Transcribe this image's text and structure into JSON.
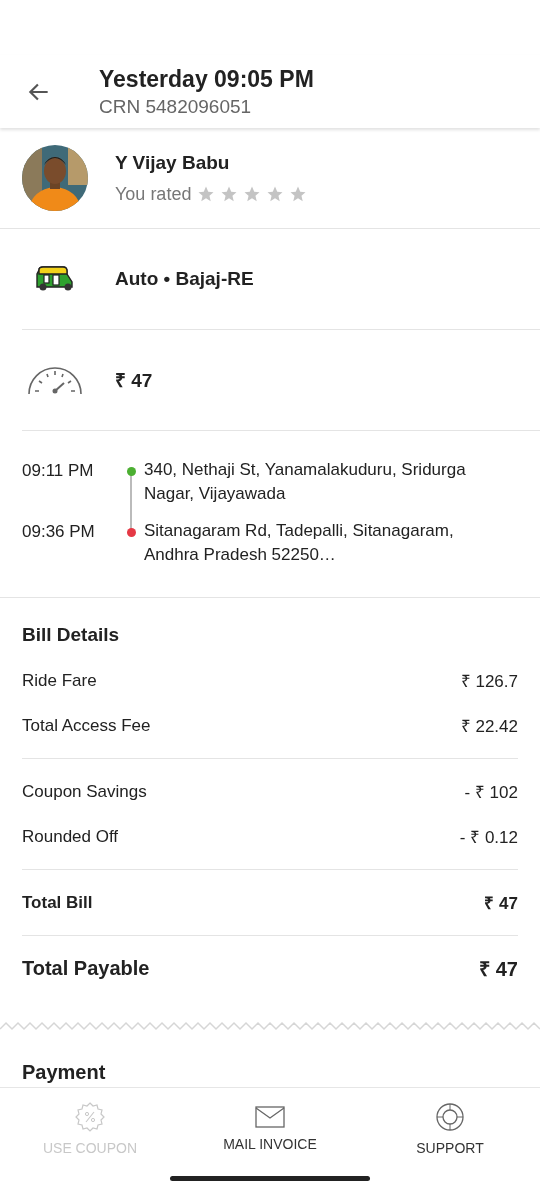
{
  "header": {
    "title": "Yesterday 09:05 PM",
    "subtitle": "CRN 5482096051"
  },
  "driver": {
    "name": "Y Vijay Babu",
    "rating_label": "You rated",
    "stars": 0
  },
  "vehicle": {
    "label": "Auto • Bajaj-RE"
  },
  "fare": {
    "amount": "₹ 47"
  },
  "route": [
    {
      "time": "09:11 PM",
      "address": "340, Nethaji St, Yanamalakuduru, Sridurga Nagar, Vijayawada",
      "color": "#4caf32"
    },
    {
      "time": "09:36 PM",
      "address": "Sitanagaram Rd, Tadepalli, Sitanagaram, Andhra Pradesh 52250…",
      "color": "#e53945"
    }
  ],
  "bill": {
    "title": "Bill Details",
    "groups": [
      [
        {
          "label": "Ride Fare",
          "value": "₹ 126.7",
          "kind": "normal"
        },
        {
          "label": "Total Access Fee",
          "value": "₹ 22.42",
          "kind": "normal"
        }
      ],
      [
        {
          "label": "Coupon Savings",
          "value": "- ₹ 102",
          "kind": "normal"
        },
        {
          "label": "Rounded Off",
          "value": "- ₹ 0.12",
          "kind": "normal"
        }
      ],
      [
        {
          "label": "Total Bill",
          "value": "₹ 47",
          "kind": "total"
        }
      ],
      [
        {
          "label": "Total Payable",
          "value": "₹ 47",
          "kind": "payable"
        }
      ]
    ]
  },
  "payment": {
    "title": "Payment"
  },
  "actions": [
    {
      "label": "USE COUPON",
      "kind": "coupon",
      "disabled": true
    },
    {
      "label": "MAIL INVOICE",
      "kind": "mail",
      "disabled": false
    },
    {
      "label": "SUPPORT",
      "kind": "support",
      "disabled": false
    }
  ]
}
